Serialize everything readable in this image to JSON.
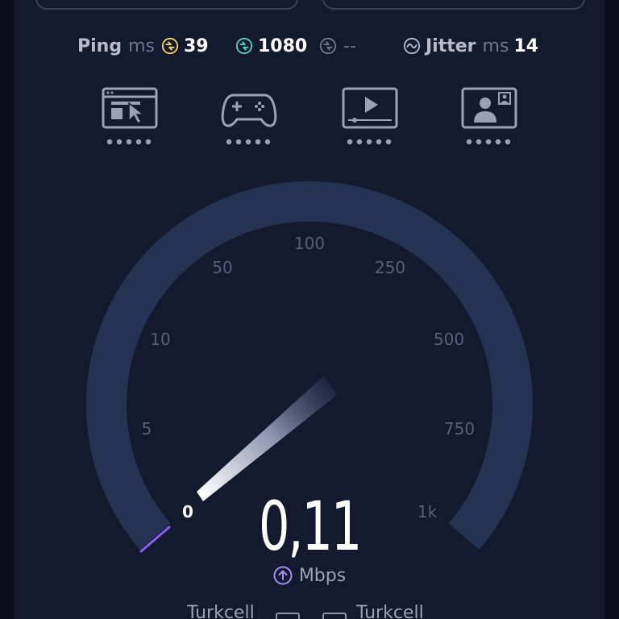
{
  "metrics": {
    "ping_label": "Ping",
    "ping_unit": "ms",
    "ping_download_value": "39",
    "ping_upload_value": "1080",
    "ping_third_value": "--",
    "jitter_label": "Jitter",
    "jitter_unit": "ms",
    "jitter_value": "14"
  },
  "usage_icons": [
    {
      "icon": "web-browsing-icon"
    },
    {
      "icon": "gaming-icon"
    },
    {
      "icon": "video-streaming-icon"
    },
    {
      "icon": "video-call-icon"
    }
  ],
  "gauge": {
    "ticks": [
      "0",
      "5",
      "10",
      "50",
      "100",
      "250",
      "500",
      "750",
      "1k"
    ],
    "speed_value": "0,11",
    "unit": "Mbps",
    "mode": "upload"
  },
  "providers": {
    "left": "Turkcell",
    "right": "Turkcell"
  },
  "colors": {
    "background": "#141a2e",
    "gauge_track": "#243352",
    "progress": "#8b5cf6",
    "download_accent": "#f4d35e",
    "upload_accent": "#4fd1c5"
  }
}
